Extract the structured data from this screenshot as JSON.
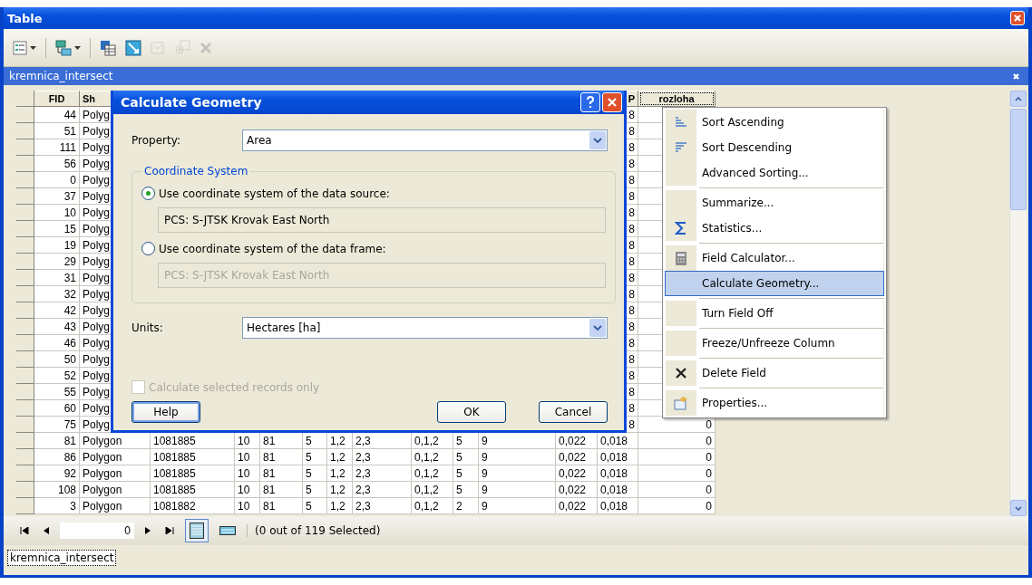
{
  "window": {
    "title": "Table"
  },
  "toolbar": [
    {
      "kind": "table-options",
      "dropdown": true,
      "disabled": false
    },
    {
      "kind": "related-tables",
      "dropdown": true,
      "disabled": false
    },
    {
      "kind": "select-by-attributes",
      "dropdown": false,
      "disabled": false
    },
    {
      "kind": "switch-selection",
      "dropdown": false,
      "disabled": false
    },
    {
      "kind": "clear-selection",
      "dropdown": false,
      "disabled": true
    },
    {
      "kind": "zoom-to-selected",
      "dropdown": false,
      "disabled": true
    },
    {
      "kind": "delete-selected",
      "dropdown": false,
      "disabled": true
    }
  ],
  "table_title": "kremnica_intersect",
  "table": {
    "header": [
      {
        "label": "FID",
        "selected": false
      },
      {
        "label": "Sh",
        "selected": false
      },
      {
        "label": "P",
        "selected": false
      },
      {
        "label": "rozloha",
        "selected": true
      }
    ],
    "rows": [
      {
        "kind": "covered",
        "cells": [
          "44",
          "Polyg",
          "",
          "",
          "",
          "",
          "",
          "",
          "",
          "",
          "",
          "",
          "8",
          ""
        ]
      },
      {
        "kind": "covered",
        "cells": [
          "51",
          "Polyg",
          "",
          "",
          "",
          "",
          "",
          "",
          "",
          "",
          "",
          "",
          "8",
          ""
        ]
      },
      {
        "kind": "covered",
        "cells": [
          "111",
          "Polyg",
          "",
          "",
          "",
          "",
          "",
          "",
          "",
          "",
          "",
          "",
          "8",
          ""
        ]
      },
      {
        "kind": "covered",
        "cells": [
          "56",
          "Polyg",
          "",
          "",
          "",
          "",
          "",
          "",
          "",
          "",
          "",
          "",
          "8",
          ""
        ]
      },
      {
        "kind": "covered",
        "cells": [
          "0",
          "Polyg",
          "",
          "",
          "",
          "",
          "",
          "",
          "",
          "",
          "",
          "",
          "8",
          ""
        ]
      },
      {
        "kind": "covered",
        "cells": [
          "37",
          "Polyg",
          "",
          "",
          "",
          "",
          "",
          "",
          "",
          "",
          "",
          "",
          "8",
          ""
        ]
      },
      {
        "kind": "covered",
        "cells": [
          "10",
          "Polyg",
          "",
          "",
          "",
          "",
          "",
          "",
          "",
          "",
          "",
          "",
          "8",
          ""
        ]
      },
      {
        "kind": "covered",
        "cells": [
          "15",
          "Polyg",
          "",
          "",
          "",
          "",
          "",
          "",
          "",
          "",
          "",
          "",
          "8",
          ""
        ]
      },
      {
        "kind": "covered",
        "cells": [
          "19",
          "Polyg",
          "",
          "",
          "",
          "",
          "",
          "",
          "",
          "",
          "",
          "",
          "8",
          ""
        ]
      },
      {
        "kind": "covered",
        "cells": [
          "29",
          "Polyg",
          "",
          "",
          "",
          "",
          "",
          "",
          "",
          "",
          "",
          "",
          "8",
          ""
        ]
      },
      {
        "kind": "covered",
        "cells": [
          "31",
          "Polyg",
          "",
          "",
          "",
          "",
          "",
          "",
          "",
          "",
          "",
          "",
          "8",
          ""
        ]
      },
      {
        "kind": "covered",
        "cells": [
          "32",
          "Polyg",
          "",
          "",
          "",
          "",
          "",
          "",
          "",
          "",
          "",
          "",
          "8",
          ""
        ]
      },
      {
        "kind": "covered",
        "cells": [
          "42",
          "Polyg",
          "",
          "",
          "",
          "",
          "",
          "",
          "",
          "",
          "",
          "",
          "8",
          ""
        ]
      },
      {
        "kind": "covered",
        "cells": [
          "43",
          "Polyg",
          "",
          "",
          "",
          "",
          "",
          "",
          "",
          "",
          "",
          "",
          "8",
          ""
        ]
      },
      {
        "kind": "covered",
        "cells": [
          "46",
          "Polyg",
          "",
          "",
          "",
          "",
          "",
          "",
          "",
          "",
          "",
          "",
          "8",
          ""
        ]
      },
      {
        "kind": "covered",
        "cells": [
          "50",
          "Polyg",
          "",
          "",
          "",
          "",
          "",
          "",
          "",
          "",
          "",
          "",
          "8",
          ""
        ]
      },
      {
        "kind": "covered",
        "cells": [
          "52",
          "Polyg",
          "",
          "",
          "",
          "",
          "",
          "",
          "",
          "",
          "",
          "",
          "8",
          ""
        ]
      },
      {
        "kind": "covered",
        "cells": [
          "55",
          "Polyg",
          "",
          "",
          "",
          "",
          "",
          "",
          "",
          "",
          "",
          "",
          "8",
          ""
        ]
      },
      {
        "kind": "covered",
        "cells": [
          "60",
          "Polyg",
          "",
          "",
          "",
          "",
          "",
          "",
          "",
          "",
          "",
          "",
          "8",
          ""
        ]
      },
      {
        "kind": "covered",
        "cells": [
          "75",
          "Polyg",
          "",
          "",
          "",
          "",
          "",
          "",
          "",
          "",
          "",
          "",
          "8",
          "0"
        ]
      },
      {
        "kind": "full",
        "cells": [
          "81",
          "Polygon",
          "1081885",
          "10",
          "81",
          "5",
          "1,2",
          "2,3",
          "0,1,2",
          "5",
          "9",
          "0,022",
          "0,018",
          "0"
        ]
      },
      {
        "kind": "full",
        "cells": [
          "86",
          "Polygon",
          "1081885",
          "10",
          "81",
          "5",
          "1,2",
          "2,3",
          "0,1,2",
          "5",
          "9",
          "0,022",
          "0,018",
          "0"
        ]
      },
      {
        "kind": "full",
        "cells": [
          "92",
          "Polygon",
          "1081885",
          "10",
          "81",
          "5",
          "1,2",
          "2,3",
          "0,1,2",
          "5",
          "9",
          "0,022",
          "0,018",
          "0"
        ]
      },
      {
        "kind": "full",
        "cells": [
          "108",
          "Polygon",
          "1081885",
          "10",
          "81",
          "5",
          "1,2",
          "2,3",
          "0,1,2",
          "5",
          "9",
          "0,022",
          "0,018",
          "0"
        ]
      },
      {
        "kind": "full",
        "cells": [
          "3",
          "Polygon",
          "1081882",
          "10",
          "81",
          "5",
          "1,2",
          "2,3",
          "0,1,2",
          "2",
          "9",
          "0,022",
          "0,018",
          "0"
        ]
      }
    ]
  },
  "navigation": {
    "record": "0",
    "views": [
      {
        "kind": "all",
        "selected": true
      },
      {
        "kind": "selected",
        "selected": false
      }
    ],
    "status": "(0 out of 119 Selected)"
  },
  "bottom_tab": "kremnica_intersect",
  "dialog": {
    "title": "Calculate Geometry",
    "property": {
      "label": "Property:",
      "value": "Area"
    },
    "coordinate_system": {
      "legend": "Coordinate System",
      "options": [
        {
          "label": "Use coordinate system of the data source:",
          "selected": true,
          "value": "PCS: S-JTSK Krovak East North",
          "disabled": false
        },
        {
          "label": "Use coordinate system of the data frame:",
          "selected": false,
          "value": "PCS: S-JTSK Krovak East North",
          "disabled": true
        }
      ]
    },
    "units": {
      "label": "Units:",
      "value": "Hectares [ha]"
    },
    "selected_only": {
      "label": "Calculate selected records only",
      "checked": false,
      "disabled": true
    },
    "buttons": [
      {
        "label": "Help",
        "focused": true
      },
      {
        "label": "OK",
        "focused": false
      },
      {
        "label": "Cancel",
        "focused": false
      }
    ]
  },
  "menu": {
    "groups": [
      {
        "items": [
          {
            "label": "Sort Ascending",
            "selected": false
          },
          {
            "label": "Sort Descending",
            "selected": false
          },
          {
            "label": "Advanced Sorting...",
            "selected": false
          }
        ]
      },
      {
        "items": [
          {
            "label": "Summarize...",
            "selected": false
          },
          {
            "label": "Statistics...",
            "selected": false
          }
        ]
      },
      {
        "items": [
          {
            "label": "Field Calculator...",
            "selected": false
          },
          {
            "label": "Calculate Geometry...",
            "selected": true
          }
        ]
      },
      {
        "items": [
          {
            "label": "Turn Field Off",
            "selected": false
          }
        ]
      },
      {
        "items": [
          {
            "label": "Freeze/Unfreeze Column",
            "selected": false
          }
        ]
      },
      {
        "items": [
          {
            "label": "Delete Field",
            "selected": false
          }
        ]
      },
      {
        "items": [
          {
            "label": "Properties...",
            "selected": false
          }
        ]
      }
    ]
  }
}
